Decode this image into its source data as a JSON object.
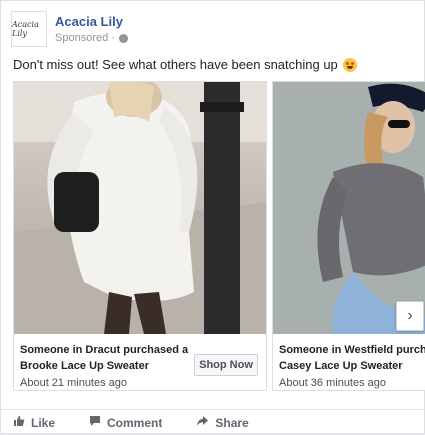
{
  "post": {
    "page_name": "Acacia Lily",
    "logo_text": "Acacia Lily",
    "sponsored_label": "Sponsored",
    "message": "Don't miss out! See what others have been snatching up"
  },
  "carousel": {
    "slides": [
      {
        "title_line1": "Someone in Dracut purchased a",
        "title_line2": "Brooke Lace Up Sweater",
        "time": "About 21 minutes ago",
        "cta": "Shop Now"
      },
      {
        "title_line1": "Someone in Westfield purchas",
        "title_line2": "Casey Lace Up Sweater",
        "time": "About 36 minutes ago"
      }
    ],
    "next_icon": "chevron-right-icon"
  },
  "actions": {
    "like": "Like",
    "comment": "Comment",
    "share": "Share"
  },
  "colors": {
    "page_name": "#365899",
    "meta_text": "#90949c",
    "action_text": "#606770"
  }
}
